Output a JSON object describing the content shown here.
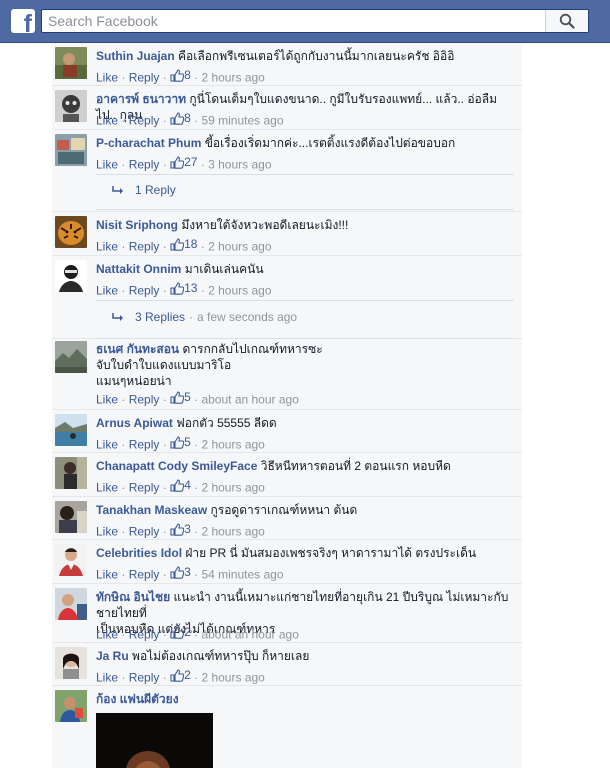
{
  "header": {
    "logo_letter": "f",
    "search_placeholder": "Search Facebook"
  },
  "actions": {
    "like": "Like",
    "reply": "Reply",
    "dot": "·"
  },
  "comments": [
    {
      "author": "Suthin Juajan",
      "text": "คือเลือกพรีเซนเตอร์ได้ถูกกับงานนี้มากเลยนะครัช อิอิอิ",
      "likes": "8",
      "time": "2 hours ago"
    },
    {
      "author": "อาคารพ์ ธนาวาท",
      "text": "กูนี่โดนเต็มๆใบแดงขนาด.. กูมีใบรับรองแพทย์... แล้ว.. อ่อลืมไป.. กุลน",
      "likes": "8",
      "time": "59 minutes ago"
    },
    {
      "author": "P-charachat Phum",
      "text": "ขี้อเรื่องเริ่ดมากค่ะ...เรตติ้งแรงดีต้องไปต่อขอบอก",
      "likes": "27",
      "time": "3 hours ago",
      "replies": "1 Reply"
    },
    {
      "author": "Nisit Sriphong",
      "text": "มึงหายใต้จังหวะพอดีเลยนะเมิง!!!",
      "likes": "18",
      "time": "2 hours ago"
    },
    {
      "author": "Nattakit Onnim",
      "text": "มาเดินเล่นคนัน",
      "likes": "13",
      "time": "2 hours ago",
      "replies": "3 Replies",
      "replies_time": "a few seconds ago"
    },
    {
      "author": "ธเนศ กันทะสอน",
      "text_lines": [
        "ดารกกลับไปเกณฑ์ทหารซะ",
        "จับใบดำใบแดงแบบมาริโอ",
        "แมนๆหน่อยน่า"
      ],
      "likes": "5",
      "time": "about an hour ago"
    },
    {
      "author": "Arnus Apiwat",
      "text": "ฟอกตัว 55555 ลีดด",
      "likes": "5",
      "time": "2 hours ago"
    },
    {
      "author": "Chanapatt Cody SmileyFace",
      "text": "วิธีหนีทหารตอนที่ 2 ตอนแรก หอบหืด",
      "likes": "4",
      "time": "2 hours ago"
    },
    {
      "author": "Tanakhan Maskeaw",
      "text": "กูรอดูดาราเกณฑ์หหนา ต้นด",
      "likes": "3",
      "time": "2 hours ago"
    },
    {
      "author": "Celebrities Idol",
      "text": "ฝ่าย PR นี่ มันสมองเพชรจริงๆ หาดารามาได้ ตรงประเด็น",
      "likes": "3",
      "time": "54 minutes ago"
    },
    {
      "author": "ทักษิณ อินไชย",
      "text_lines": [
        "แนะนำ งานนี้เหมาะแก่ชายไทยที่อายุเกิน 21 ปีบริบูณ ไม่เหมาะกับชายไทยที่",
        "เป็นหอบหืด แต่ยังไม่ได้เกณฑ์ทหาร"
      ],
      "likes": "2",
      "time": "about an hour ago"
    },
    {
      "author": "Ja Ru",
      "text": "พอไม่ต้องเกณฑ์ทหารปุ๊บ ก็หายเลย",
      "likes": "2",
      "time": "2 hours ago"
    },
    {
      "author": "ก้อง แฟนผีตัวยง"
    }
  ]
}
